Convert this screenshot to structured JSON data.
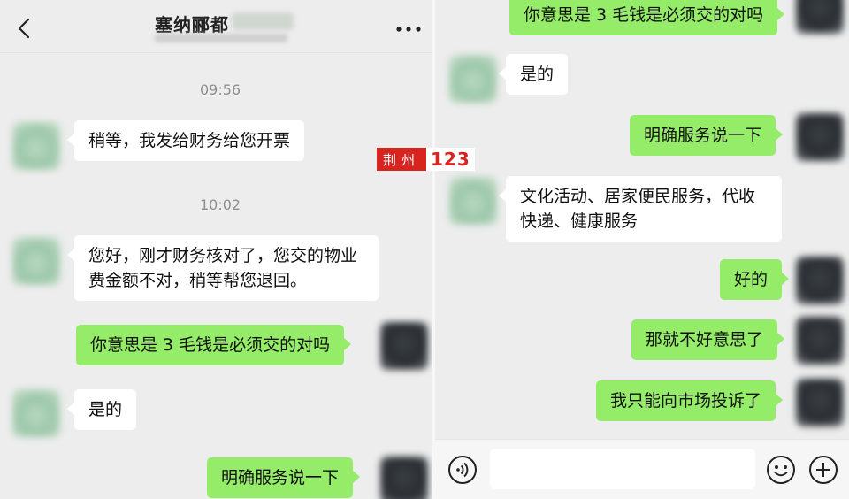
{
  "header": {
    "title": "塞纳郦都"
  },
  "left_messages": {
    "time1": "09:56",
    "m1": "稍等，我发给财务给您开票",
    "time2": "10:02",
    "m2": "您好，刚才财务核对了，您交的物业费金额不对，稍等帮您退回。",
    "m3": "你意思是 3 毛钱是必须交的对吗",
    "m4": "是的",
    "m5": "明确服务说一下"
  },
  "right_messages": {
    "r1": "你意思是 3 毛钱是必须交的对吗",
    "r2": "是的",
    "r3": "明确服务说一下",
    "r4": "文化活动、居家便民服务，代收快递、健康服务",
    "r5": "好的",
    "r6": "那就不好意思了",
    "r7": "我只能向市场投诉了"
  },
  "watermark": {
    "seal_text": "荆州",
    "number": "123"
  },
  "input_bar": {
    "value": ""
  },
  "icons": [
    "back-icon",
    "more-icon",
    "voice-icon",
    "emoji-icon",
    "plus-icon"
  ],
  "colors": {
    "background": "#ededed",
    "outgoing_bubble": "#95ec69",
    "incoming_bubble": "#ffffff",
    "timestamp": "#8f8f8f",
    "watermark_red": "#d8241f"
  }
}
